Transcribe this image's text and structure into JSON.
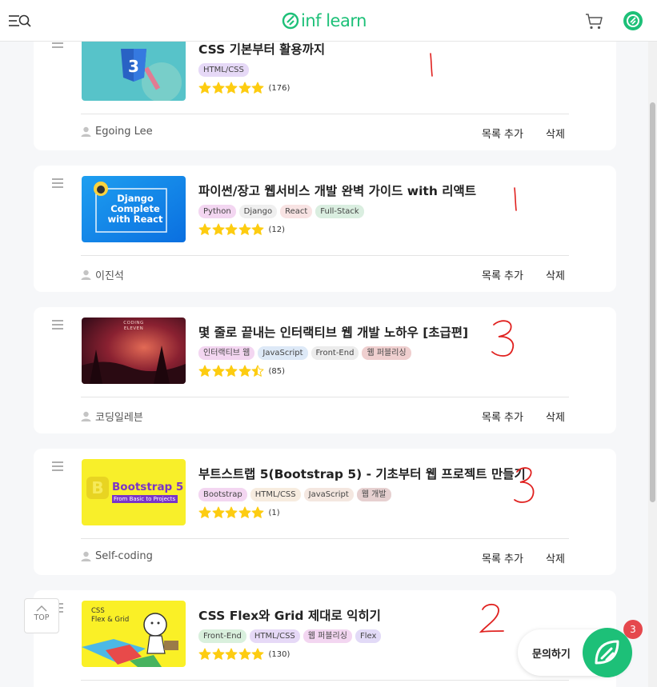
{
  "header": {
    "logo_text": "inf learn",
    "brand_color": "#1dc078"
  },
  "courses": [
    {
      "title": "CSS 기본부터 활용까지",
      "tags": [
        "HTML/CSS"
      ],
      "rating": 5,
      "review_count": "(176)",
      "author": "Egoing Lee",
      "add_to_list": "목록 추가",
      "delete": "삭제",
      "annotation": "1"
    },
    {
      "title": "파이썬/장고 웹서비스 개발 완벽 가이드 with 리액트",
      "tags": [
        "Python",
        "Django",
        "React",
        "Full-Stack"
      ],
      "rating": 5,
      "review_count": "(12)",
      "author": "이진석",
      "add_to_list": "목록 추가",
      "delete": "삭제",
      "annotation": "1",
      "thumb_text": [
        "Django",
        "Complete",
        "with React"
      ]
    },
    {
      "title": "몇 줄로 끝내는 인터랙티브 웹 개발 노하우 [초급편]",
      "tags": [
        "인터랙티브 웹",
        "JavaScript",
        "Front-End",
        "웹 퍼블리싱"
      ],
      "rating": 4.5,
      "review_count": "(85)",
      "author": "코딩일레븐",
      "add_to_list": "목록 추가",
      "delete": "삭제",
      "annotation": "3",
      "thumb_text": [
        "CODING",
        "ELEVEN"
      ]
    },
    {
      "title": "부트스트랩 5(Bootstrap 5) - 기초부터 웹 프로젝트 만들기",
      "tags": [
        "Bootstrap",
        "HTML/CSS",
        "JavaScript",
        "웹 개발"
      ],
      "rating": 5,
      "review_count": "(1)",
      "author": "Self-coding",
      "add_to_list": "목록 추가",
      "delete": "삭제",
      "annotation": "3",
      "thumb_text": [
        "Bootstrap 5",
        "From Basic to Projects"
      ]
    },
    {
      "title": "CSS Flex와 Grid 제대로 익히기",
      "tags": [
        "Front-End",
        "HTML/CSS",
        "웹 퍼블리싱",
        "Flex"
      ],
      "rating": 5,
      "review_count": "(130)",
      "annotation": "2",
      "thumb_text": [
        "CSS",
        "Flex & Grid"
      ]
    }
  ],
  "top_button_label": "TOP",
  "inquiry": {
    "label": "문의하기",
    "badge_count": "3"
  },
  "colors": {
    "star": "#fdcc11",
    "annotation_ink": "#e0211f",
    "badge": "#e5484d"
  }
}
